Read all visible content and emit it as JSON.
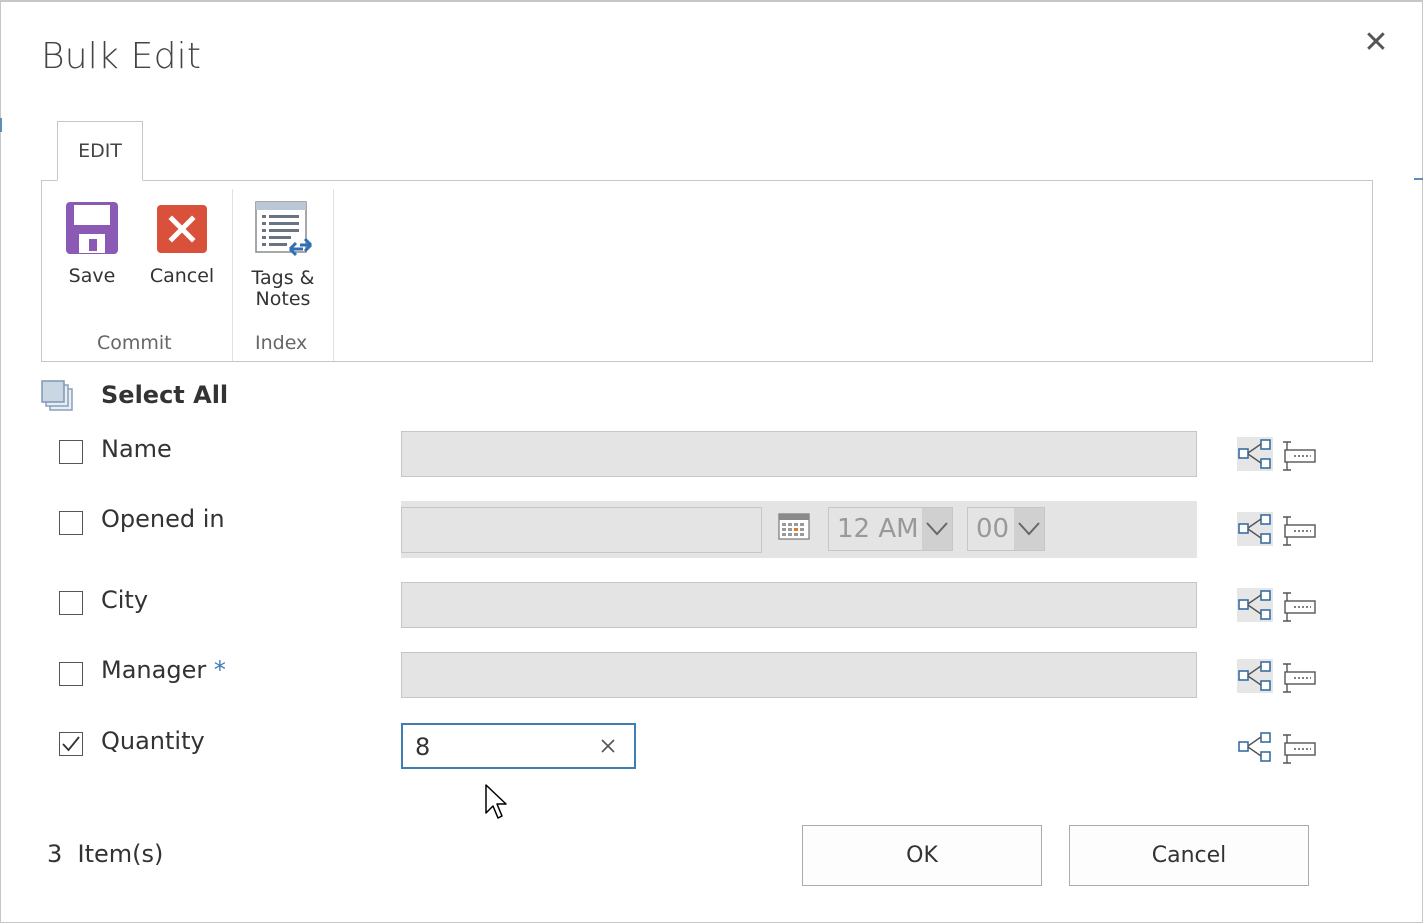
{
  "dialog": {
    "title": "Bulk Edit",
    "close_icon": "close-icon"
  },
  "ribbon": {
    "tab_label": "EDIT",
    "groups": [
      {
        "label": "Commit",
        "buttons": [
          {
            "label": "Save",
            "icon": "save-icon",
            "color": "#8a5ab5"
          },
          {
            "label": "Cancel",
            "icon": "cancel-icon",
            "color": "#d9513a"
          }
        ]
      },
      {
        "label": "Index",
        "buttons": [
          {
            "label_line1": "Tags &",
            "label_line2": "Notes",
            "icon": "tags-notes-icon"
          }
        ]
      }
    ]
  },
  "form": {
    "select_all_label": "Select All",
    "fields": [
      {
        "label": "Name",
        "checked": false,
        "value": ""
      },
      {
        "label": "Opened in",
        "checked": false,
        "value": "",
        "hour": "12 AM",
        "minute": "00"
      },
      {
        "label": "City",
        "checked": false,
        "value": ""
      },
      {
        "label": "Manager",
        "required_marker": "*",
        "checked": false,
        "value": ""
      },
      {
        "label": "Quantity",
        "checked": true,
        "value": "8"
      }
    ],
    "row_action_icons": [
      "hierarchy-icon",
      "field-properties-icon"
    ]
  },
  "footer": {
    "item_count": "3",
    "item_label": "Item(s)",
    "ok_label": "OK",
    "cancel_label": "Cancel"
  },
  "colors": {
    "accent": "#3e7eb5",
    "disabled_field": "#e4e4e4"
  }
}
